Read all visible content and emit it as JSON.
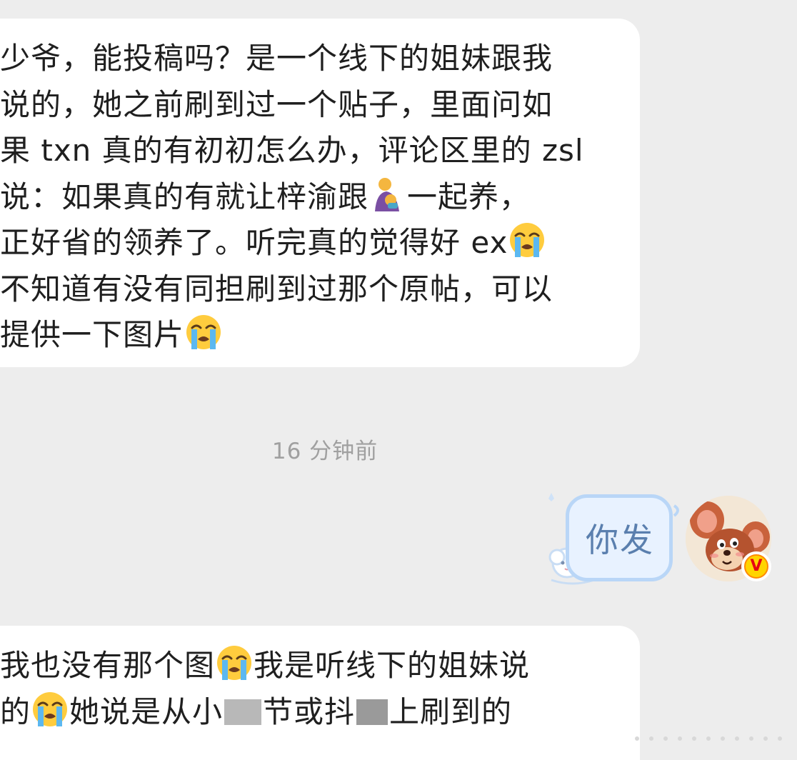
{
  "messages": {
    "incoming_1": {
      "lines": [
        "少爷，能投稿吗？是一个线下的姐妹跟我",
        "说的，她之前刷到过一个贴子，里面问如",
        "果 txn 真的有初初怎么办，评论区里的 zsl",
        "说：如果真的有就让梓渝跟",
        "一起养，",
        "正好省的领养了。听完真的觉得好 ex",
        "不知道有没有同担刷到过那个原帖，可以",
        "提供一下图片"
      ]
    },
    "timestamp": "16 分钟前",
    "outgoing_sticker": {
      "text": "你发"
    },
    "incoming_2": {
      "lines": [
        "我也没有那个图",
        "我是听线下的姐妹说",
        "的",
        "她说是从小",
        "节或抖",
        "上刷到的"
      ]
    }
  },
  "colors": {
    "background": "#ededed",
    "bubble": "#ffffff",
    "timestamp": "#a0a0a0",
    "sticker_border": "#b9d6f7",
    "badge": "#ff8a00"
  },
  "icons": {
    "crying_emoji": "loudly-crying-face-icon",
    "person_feeding_baby": "man-feeding-baby-icon",
    "verified_badge": "v-badge-icon",
    "avatar": "jerry-mouse-avatar"
  }
}
